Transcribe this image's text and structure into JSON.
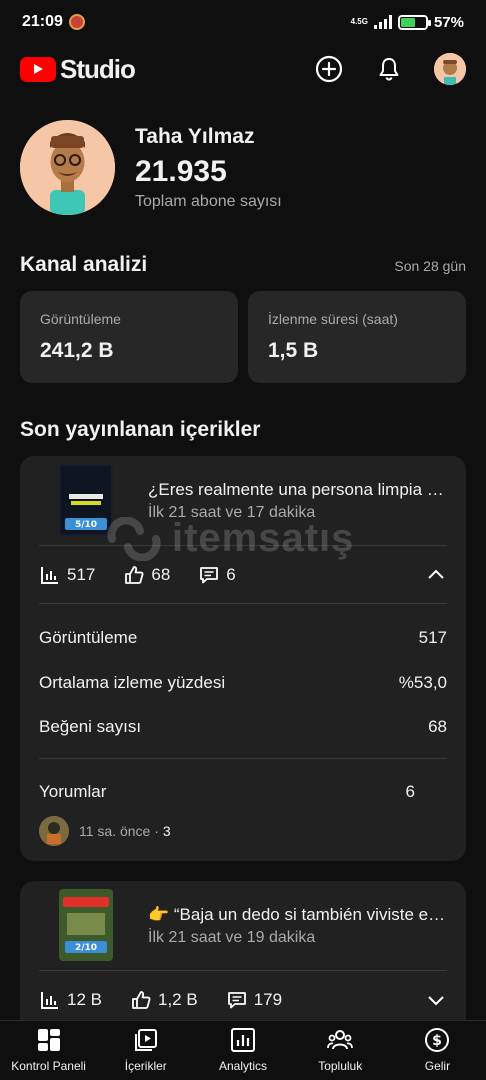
{
  "status_bar": {
    "time": "21:09",
    "network": "4.5G",
    "battery": "57%"
  },
  "header": {
    "logo_text": "Studio"
  },
  "channel": {
    "name": "Taha Yılmaz",
    "subscribers": "21.935",
    "subscribers_label": "Toplam abone sayısı"
  },
  "analytics": {
    "title": "Kanal analizi",
    "period": "Son 28 gün",
    "views_label": "Görüntüleme",
    "views_value": "241,2 B",
    "watch_time_label": "İzlenme süresi (saat)",
    "watch_time_value": "1,5 B"
  },
  "recent": {
    "title": "Son yayınlanan içerikler",
    "videos": [
      {
        "title": "¿Eres realmente una persona limpia y ordenada?",
        "age": "İlk 21 saat ve 17 dakika",
        "views": "517",
        "likes": "68",
        "comments": "6",
        "thumb_label": "5/10",
        "details": {
          "views_label": "Görüntüleme",
          "views_value": "517",
          "avg_label": "Ortalama izleme yüzdesi",
          "avg_value": "%53,0",
          "likes_label": "Beğeni sayısı",
          "likes_value": "68",
          "comments_label": "Yorumlar",
          "comments_value": "6",
          "latest_comment_time": "11 sa. önce ·",
          "latest_comment_count": "3"
        }
      },
      {
        "title": "👉 “Baja un dedo si también viviste esto”",
        "age": "İlk 21 saat ve 19 dakika",
        "views": "12 B",
        "likes": "1,2 B",
        "comments": "179",
        "thumb_label": "2/10"
      }
    ]
  },
  "watermark": {
    "text": "itemsatış"
  },
  "nav": {
    "dashboard": "Kontrol Paneli",
    "content": "İçerikler",
    "analytics": "Analytics",
    "community": "Topluluk",
    "earn": "Gelir"
  }
}
